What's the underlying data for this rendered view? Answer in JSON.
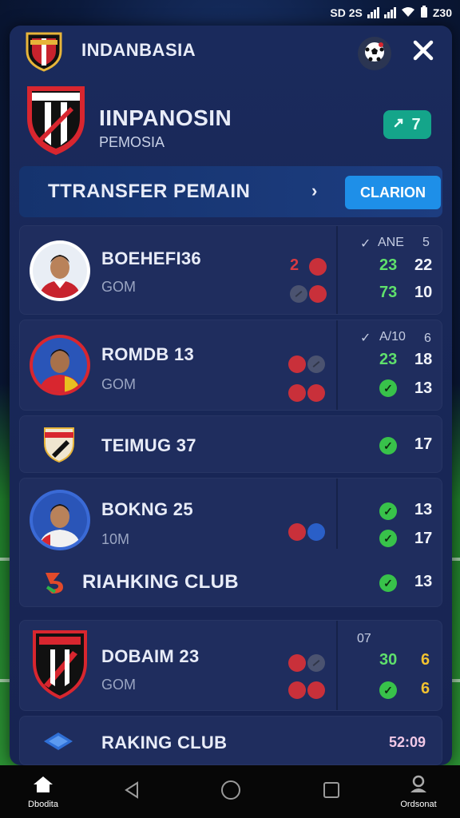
{
  "status_bar": {
    "time": "Z30",
    "left_text": "SD 2S"
  },
  "header": {
    "app_title": "INDANBASIA",
    "ball_icon": "soccer-ball-icon",
    "close_icon": "close-icon"
  },
  "club": {
    "name": "IINPANOSIN",
    "subtitle": "PEMOSIA",
    "badge_value": "7",
    "badge_icon": "swap-arrows-icon"
  },
  "transfer": {
    "title": "TTRANSFER PEMAIN",
    "button_label": "CLARION"
  },
  "rows": [
    {
      "name": "BOEHEFI36",
      "sub": "GOM",
      "dot_text": "2",
      "stat_header": "ANE",
      "stat_header_right": "5",
      "stat_a1": "23",
      "stat_a2": "22",
      "stat_b1": "73",
      "stat_b2": "10"
    },
    {
      "name": "ROMDB 13",
      "sub": "GOM",
      "stat_header": "A/10",
      "stat_header_right": "6",
      "stat_a1": "23",
      "stat_a2": "18",
      "stat_b2": "13"
    },
    {
      "name": "TEIMUG 37",
      "stat_b2": "17"
    },
    {
      "name": "BOKNG 25",
      "sub": "10M",
      "stat_a2": "13",
      "stat_b2": "17"
    },
    {
      "name": "RIAHKING CLUB",
      "stat_b2": "13"
    },
    {
      "name": "DOBAIM 23",
      "sub": "GOM",
      "stat_header": "07",
      "stat_a1": "30",
      "stat_a2": "6",
      "stat_b2": "6"
    },
    {
      "name": "RAKING CLUB",
      "stat_b2": "52:09"
    }
  ],
  "nav": {
    "home_label": "Dbodita",
    "profile_label": "Ordsonat"
  },
  "colors": {
    "accent_teal": "#14a58a",
    "accent_blue": "#1e8fe8",
    "stat_green": "#5fe06c",
    "stat_yellow": "#f2c230",
    "dot_red": "#c9303a"
  }
}
